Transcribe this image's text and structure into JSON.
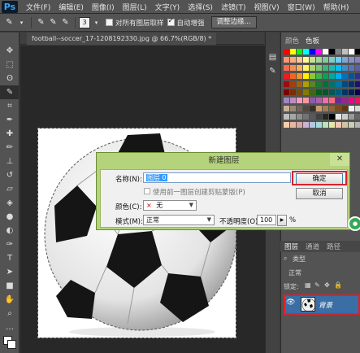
{
  "app": {
    "logo": "Ps",
    "menu": [
      "文件(F)",
      "编辑(E)",
      "图像(I)",
      "图层(L)",
      "文字(Y)",
      "选择(S)",
      "滤镜(T)",
      "视图(V)",
      "窗口(W)",
      "帮助(H)"
    ]
  },
  "options_bar": {
    "brush_size": "3",
    "sample_all_layers": "对所有图层取样",
    "auto_enhance": "自动增强",
    "refine_edge": "调整边缘..."
  },
  "document": {
    "tab_label": "football--soccer_17-1208192330.jpg @ 66.7%(RGB/8) *"
  },
  "panels": {
    "color_tab": "颜色",
    "swatches_tab": "色板",
    "layers_tab": "图层",
    "channels_tab": "通道",
    "paths_tab": "路径",
    "kind_label": "类型",
    "blend_label": "正常",
    "lock_label": "锁定:",
    "layer_name": "背景"
  },
  "dialog": {
    "title": "新建图层",
    "name_label": "名称(N):",
    "name_value": "图层 0",
    "clip_option": "使用前一图层创建剪贴蒙版(P)",
    "color_label": "颜色(C):",
    "color_value": "无",
    "color_prefix": "×",
    "mode_label": "模式(M):",
    "mode_value": "正常",
    "opacity_label": "不透明度(O):",
    "opacity_value": "100",
    "opacity_unit": "%",
    "ok": "确定",
    "cancel": "取消"
  },
  "colors": {
    "highlight": "#d9232a",
    "dialog_frame": "#b4d37a",
    "layer_selected": "#3b6ea5"
  }
}
